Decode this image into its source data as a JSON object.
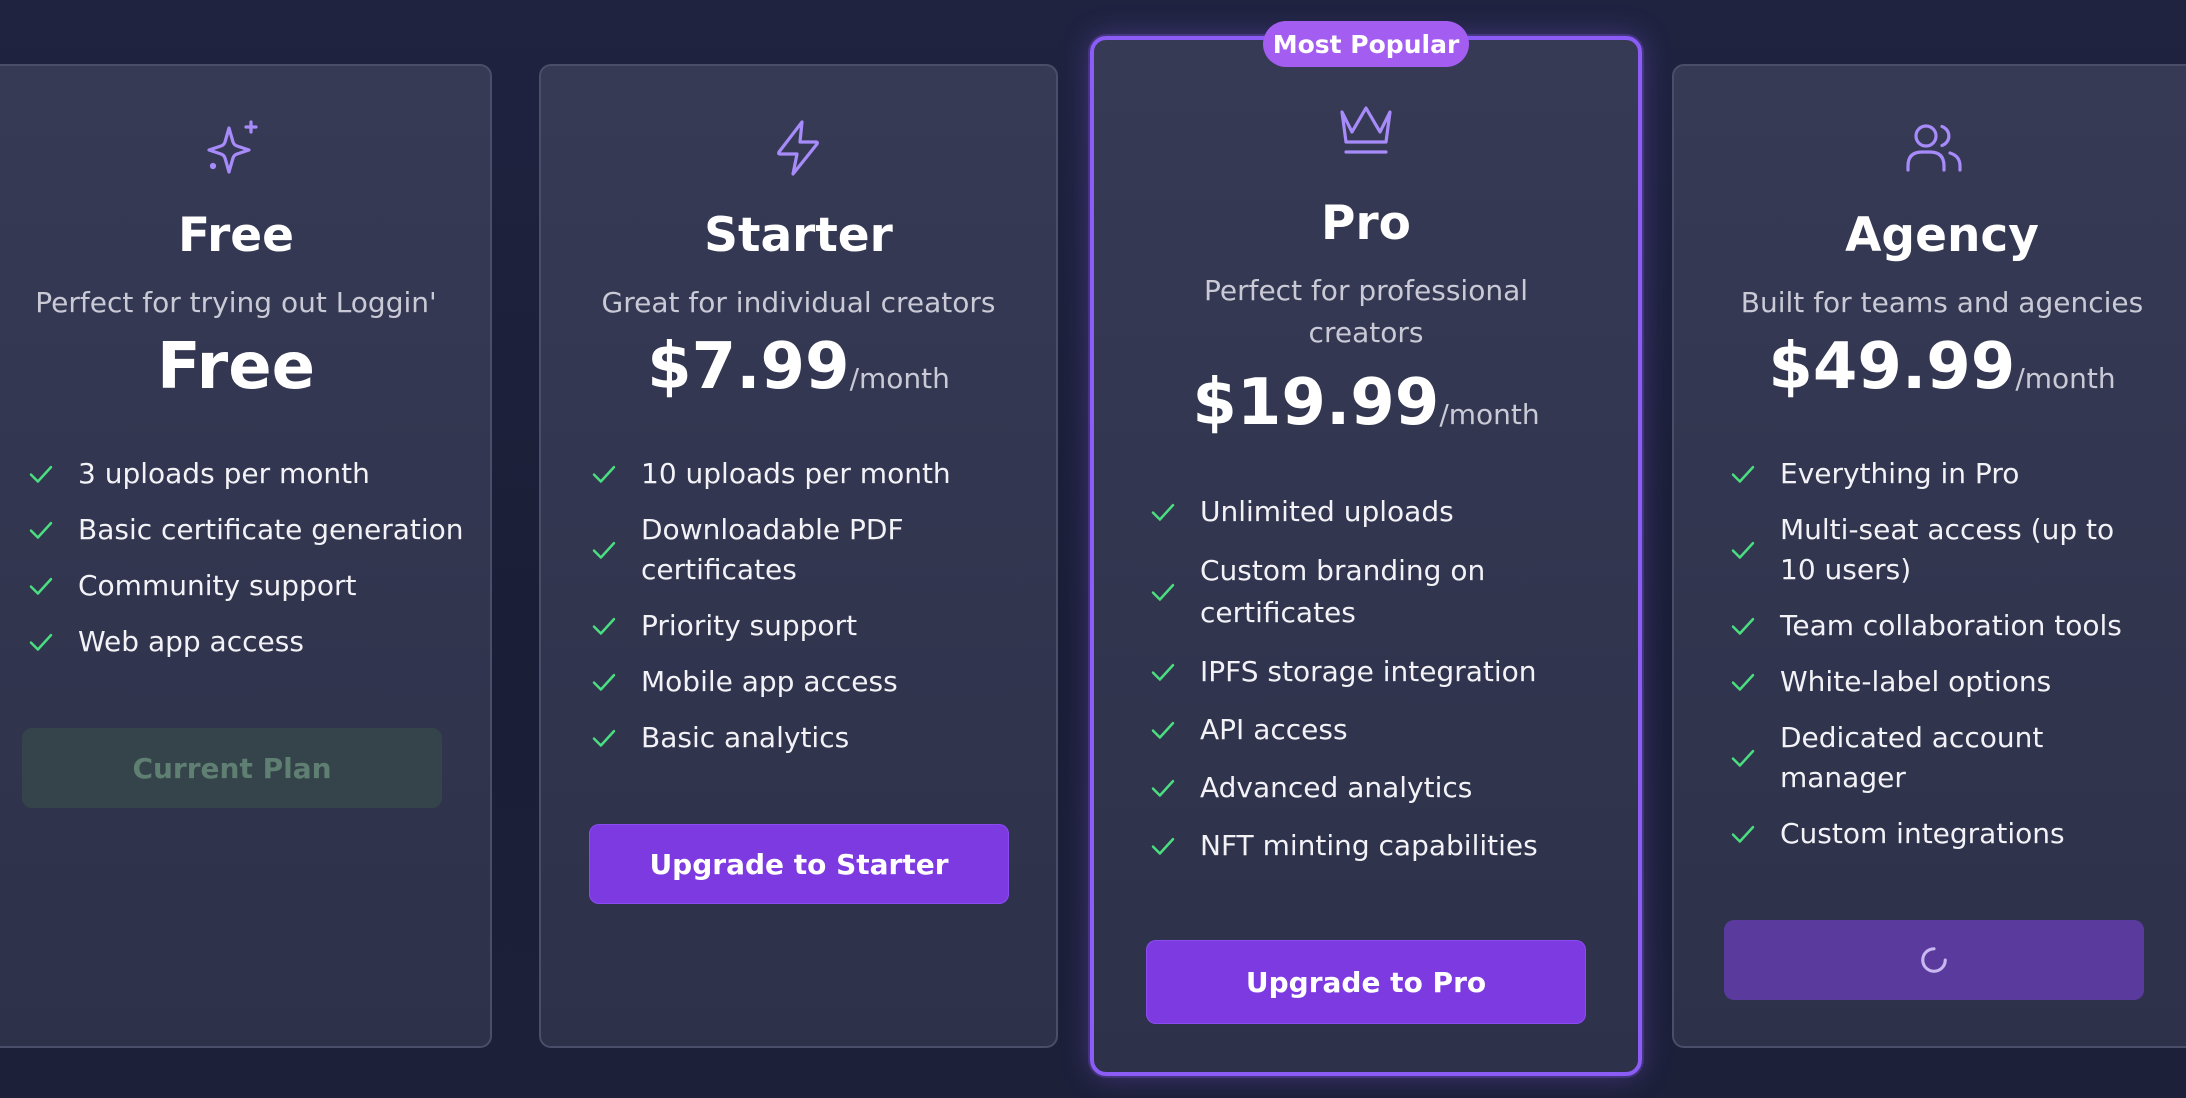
{
  "badge": {
    "label": "Most Popular"
  },
  "plans": [
    {
      "name": "Free",
      "icon": "sparkles-icon",
      "description": "Perfect for trying out Loggin'",
      "price": "Free",
      "period": "",
      "features": [
        "3 uploads per month",
        "Basic certificate generation",
        "Community support",
        "Web app access"
      ],
      "button": {
        "label": "Current Plan",
        "state": "current"
      }
    },
    {
      "name": "Starter",
      "icon": "lightning-icon",
      "description": "Great for individual creators",
      "price": "$7.99",
      "period": "/month",
      "features": [
        "10 uploads per month",
        "Downloadable PDF certificates",
        "Priority support",
        "Mobile app access",
        "Basic analytics"
      ],
      "button": {
        "label": "Upgrade to Starter",
        "state": "primary"
      }
    },
    {
      "name": "Pro",
      "icon": "crown-icon",
      "description": "Perfect for professional creators",
      "price": "$19.99",
      "period": "/month",
      "features": [
        "Unlimited uploads",
        "Custom branding on certificates",
        "IPFS storage integration",
        "API access",
        "Advanced analytics",
        "NFT minting capabilities"
      ],
      "button": {
        "label": "Upgrade to Pro",
        "state": "primary"
      }
    },
    {
      "name": "Agency",
      "icon": "users-icon",
      "description": "Built for teams and agencies",
      "price": "$49.99",
      "period": "/month",
      "features": [
        "Everything in Pro",
        "Multi-seat access (up to 10 users)",
        "Team collaboration tools",
        "White-label options",
        "Dedicated account manager",
        "Custom integrations"
      ],
      "button": {
        "label": "",
        "state": "loading"
      }
    }
  ],
  "colors": {
    "accent": "#8b5cf6",
    "button": "#7c3ae0",
    "check": "#4ade80",
    "icon": "#a78bfa"
  }
}
